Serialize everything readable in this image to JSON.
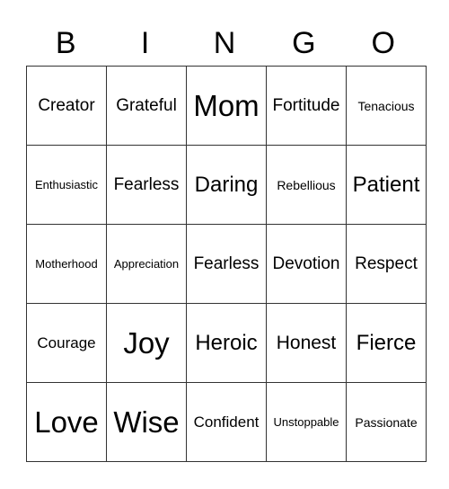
{
  "header": [
    "B",
    "I",
    "N",
    "G",
    "O"
  ],
  "rows": [
    [
      {
        "text": "Creator",
        "size": "s4"
      },
      {
        "text": "Grateful",
        "size": "s4"
      },
      {
        "text": "Mom",
        "size": "s7"
      },
      {
        "text": "Fortitude",
        "size": "s4"
      },
      {
        "text": "Tenacious",
        "size": "s2"
      }
    ],
    [
      {
        "text": "Enthusiastic",
        "size": "s1"
      },
      {
        "text": "Fearless",
        "size": "s4"
      },
      {
        "text": "Daring",
        "size": "s6"
      },
      {
        "text": "Rebellious",
        "size": "s2"
      },
      {
        "text": "Patient",
        "size": "s6"
      }
    ],
    [
      {
        "text": "Motherhood",
        "size": "s1"
      },
      {
        "text": "Appreciation",
        "size": "s1"
      },
      {
        "text": "Fearless",
        "size": "s4"
      },
      {
        "text": "Devotion",
        "size": "s4"
      },
      {
        "text": "Respect",
        "size": "s4"
      }
    ],
    [
      {
        "text": "Courage",
        "size": "s3"
      },
      {
        "text": "Joy",
        "size": "s7"
      },
      {
        "text": "Heroic",
        "size": "s6"
      },
      {
        "text": "Honest",
        "size": "s5"
      },
      {
        "text": "Fierce",
        "size": "s6"
      }
    ],
    [
      {
        "text": "Love",
        "size": "s7"
      },
      {
        "text": "Wise",
        "size": "s7"
      },
      {
        "text": "Confident",
        "size": "s3"
      },
      {
        "text": "Unstoppable",
        "size": "s1"
      },
      {
        "text": "Passionate",
        "size": "s2"
      }
    ]
  ]
}
